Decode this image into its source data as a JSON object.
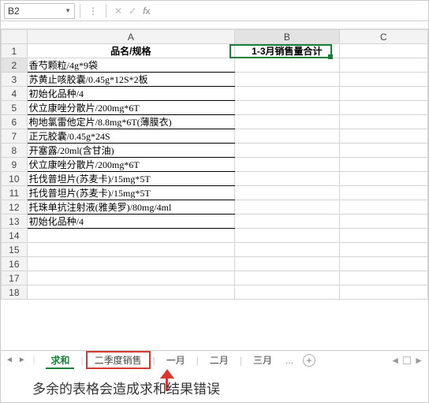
{
  "namebox": {
    "cellref": "B2"
  },
  "formula": "",
  "columns": [
    "A",
    "B",
    "C"
  ],
  "headerRow": {
    "a": "品名/规格",
    "b": "1-3月销售量合计"
  },
  "rows": [
    "香芍颗粒/4g*9袋",
    "苏黄止咳胶囊/0.45g*12S*2板",
    "初始化品种/4",
    "伏立康唑分散片/200mg*6T",
    "枸地氯雷他定片/8.8mg*6T(薄膜衣)",
    "正元胶囊/0.45g*24S",
    "开塞露/20ml(含甘油)",
    "伏立康唑分散片/200mg*6T",
    "托伐普坦片(苏麦卡)/15mg*5T",
    "托伐普坦片(苏麦卡)/15mg*5T",
    "托珠单抗注射液(雅美罗)/80mg/4ml",
    "初始化品种/4"
  ],
  "emptyRows": [
    14,
    15,
    16,
    17,
    18
  ],
  "tabs": {
    "active": "求和",
    "highlight": "二季度销售",
    "others": [
      "一月",
      "二月",
      "三月"
    ],
    "dots": "...",
    "plus": "+"
  },
  "caption": "多余的表格会造成求和结果错误",
  "chart_data": {
    "type": "table",
    "columns": [
      "品名/规格",
      "1-3月销售量合计"
    ],
    "data": [
      [
        "香芍颗粒/4g*9袋",
        null
      ],
      [
        "苏黄止咳胶囊/0.45g*12S*2板",
        null
      ],
      [
        "初始化品种/4",
        null
      ],
      [
        "伏立康唑分散片/200mg*6T",
        null
      ],
      [
        "枸地氯雷他定片/8.8mg*6T(薄膜衣)",
        null
      ],
      [
        "正元胶囊/0.45g*24S",
        null
      ],
      [
        "开塞露/20ml(含甘油)",
        null
      ],
      [
        "伏立康唑分散片/200mg*6T",
        null
      ],
      [
        "托伐普坦片(苏麦卡)/15mg*5T",
        null
      ],
      [
        "托伐普坦片(苏麦卡)/15mg*5T",
        null
      ],
      [
        "托珠单抗注射液(雅美罗)/80mg/4ml",
        null
      ],
      [
        "初始化品种/4",
        null
      ]
    ]
  }
}
